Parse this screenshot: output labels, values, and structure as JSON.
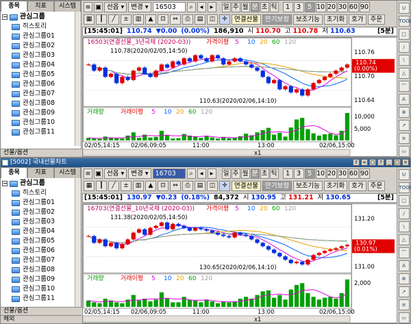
{
  "windows": [
    {
      "title": "",
      "left_tabs": [
        "종목",
        "지표",
        "시스템"
      ],
      "tree_root": "관심그룹",
      "tree_items": [
        "히스토리",
        "관심그룹01",
        "관심그룹02",
        "관심그룹03",
        "관심그룹04",
        "관심그룹05",
        "관심그룹06",
        "관심그룹07",
        "관심그룹08",
        "관심그룹09",
        "관심그룹10",
        "관심그룹11"
      ],
      "left_bottom": "선물/옵션",
      "toolbar": {
        "select_label": "선옵",
        "change_label": "변경",
        "code": "16503",
        "periods": [
          "일",
          "주",
          "월",
          "분",
          "초",
          "틱"
        ],
        "numbers": [
          "1",
          "3",
          "5",
          "10",
          "20",
          "30",
          "60",
          "90"
        ]
      },
      "toolbar2": {
        "linked_label": "연결선물",
        "expiry_label": "만기보정",
        "aux_label": "보조기능",
        "init_label": "초기화",
        "quote_label": "호가",
        "order_label": "주문"
      },
      "info": {
        "time": "[15:45:01]",
        "price": "110.74",
        "change": "▼0.00",
        "pct": "(0.00%)",
        "volume": "186,910",
        "open_label": "시",
        "open": "110.70",
        "high_label": "고",
        "high": "110.78",
        "low_label": "저",
        "low": "110.63",
        "interval": "[5분]"
      },
      "legend_title": "16503(연결선물_3년국채 (2020-03))",
      "legend_ma_label": "가격이평",
      "legend_ma_periods": [
        "5",
        "10",
        "20",
        "60",
        "120"
      ],
      "high_note": "110.78(2020/02/05,14:50)",
      "low_note": "110.63(2020/02/06,14:10)",
      "y_ticks": [
        "110.76",
        "110.70",
        "110.64"
      ],
      "last_price": "110.74",
      "last_pct": "(0.00%)",
      "vol_legend": "거래량",
      "vol_ma_label": "거래이평",
      "vol_ma_periods": [
        "5",
        "10",
        "20",
        "60",
        "120"
      ],
      "vol_ticks": [
        "10,000",
        "5,000"
      ],
      "x_labels": [
        "02/05,14:15",
        "02/06,09:05",
        "11:00",
        "13:00",
        "02/06,15:00"
      ],
      "scale": "x1"
    },
    {
      "title": "[5002] 국내선물차트",
      "left_tabs": [
        "종목",
        "지표",
        "시스템"
      ],
      "tree_root": "관심그룹",
      "tree_items": [
        "히스토리",
        "관심그룹01",
        "관심그룹02",
        "관심그룹03",
        "관심그룹04",
        "관심그룹05",
        "관심그룹06",
        "관심그룹07",
        "관심그룹08",
        "관심그룹09",
        "관심그룹10",
        "관심그룹11"
      ],
      "left_bottom": "선물/옵션",
      "left_bottom2": "해외",
      "toolbar": {
        "select_label": "선옵",
        "change_label": "변경",
        "code": "16703",
        "periods": [
          "일",
          "주",
          "월",
          "분",
          "초",
          "틱"
        ],
        "numbers": [
          "1",
          "3",
          "5",
          "10",
          "20",
          "30",
          "60",
          "90"
        ]
      },
      "toolbar2": {
        "linked_label": "연결선물",
        "expiry_label": "만기보정",
        "aux_label": "보조기능",
        "init_label": "초기화",
        "quote_label": "호가",
        "order_label": "주문"
      },
      "info": {
        "time": "[15:45:01]",
        "price": "130.97",
        "change": "▼0.23",
        "pct": "(0.18%)",
        "volume": "84,372",
        "open_label": "시",
        "open": "130.95",
        "high_label": "고",
        "high": "131.21",
        "low_label": "저",
        "low": "130.65",
        "interval": "[5분]"
      },
      "legend_title": "16703(연결선물_10년국채 (2020-03))",
      "legend_ma_label": "가격이평",
      "legend_ma_periods": [
        "5",
        "10",
        "20",
        "60",
        "120"
      ],
      "high_note": "131.38(2020/02/05,14:50)",
      "low_note": "130.65(2020/02/06,14:10)",
      "y_ticks": [
        "131.20",
        "131.00"
      ],
      "last_price": "130.97",
      "last_pct": "(0.01%)",
      "vol_legend": "거래량",
      "vol_ma_label": "거래이평",
      "vol_ma_periods": [
        "5",
        "10",
        "20",
        "60",
        "120"
      ],
      "vol_ticks": [
        "2,000"
      ],
      "x_labels": [
        "02/05,14:15",
        "02/06,09:05",
        "11:00",
        "13:00",
        "02/06,15:00"
      ],
      "scale": "x1"
    }
  ],
  "right_tools": [
    "U",
    "TOOL",
    "□",
    "/",
    "\\",
    "△",
    "⌒",
    "A",
    "⊕",
    "↗",
    "≡",
    "▭"
  ],
  "colors": {
    "up": "#e00000",
    "down": "#0030e0",
    "ma5": "#e000e0",
    "ma10": "#0060ff",
    "ma20": "#e8a000",
    "ma60": "#00a000",
    "ma120": "#a0a0a0",
    "volume": "#00a000",
    "last_bg": "#e00000"
  },
  "chart_data": [
    {
      "type": "candlestick",
      "title": "16503(연결선물_3년국채 (2020-03))",
      "ylim": [
        110.61,
        110.8
      ],
      "close": [
        110.74,
        110.72,
        110.73,
        110.7,
        110.71,
        110.68,
        110.7,
        110.69,
        110.72,
        110.73,
        110.71,
        110.7,
        110.72,
        110.74,
        110.73,
        110.75,
        110.74,
        110.76,
        110.75,
        110.77,
        110.76,
        110.75,
        110.77,
        110.76,
        110.74,
        110.75,
        110.76,
        110.75,
        110.74,
        110.73,
        110.72,
        110.7,
        110.68,
        110.69,
        110.66,
        110.67,
        110.65,
        110.66,
        110.64,
        110.66,
        110.68,
        110.69,
        110.7,
        110.71,
        110.72,
        110.73,
        110.74
      ],
      "volume": [
        800,
        600,
        500,
        1200,
        900,
        700,
        600,
        1500,
        2500,
        800,
        1800,
        900,
        1100,
        3000,
        1600,
        600,
        700,
        2000,
        1500,
        1200,
        800,
        1400,
        900,
        600,
        1100,
        700,
        800,
        1300,
        2100,
        1600,
        2500,
        3200,
        3900,
        1800,
        2400,
        1200,
        4000,
        6500,
        7000,
        3500,
        2200,
        1500,
        1900,
        2100,
        1600,
        3000,
        8500
      ]
    },
    {
      "type": "candlestick",
      "title": "16703(연결선물_10년국채 (2020-03))",
      "ylim": [
        130.58,
        131.45
      ],
      "close": [
        131.1,
        131.0,
        131.05,
        130.95,
        131.0,
        130.92,
        130.98,
        131.05,
        131.15,
        131.2,
        131.12,
        131.22,
        131.25,
        131.3,
        131.2,
        131.28,
        131.25,
        131.22,
        131.18,
        131.22,
        131.2,
        131.18,
        131.15,
        131.12,
        131.1,
        131.08,
        131.15,
        131.12,
        131.1,
        131.05,
        131.0,
        130.95,
        130.9,
        130.85,
        130.8,
        130.75,
        130.7,
        130.72,
        130.68,
        130.75,
        130.82,
        130.85,
        130.88,
        130.9,
        130.92,
        130.95,
        130.97
      ],
      "volume": [
        700,
        500,
        400,
        900,
        700,
        500,
        400,
        800,
        1300,
        700,
        900,
        600,
        800,
        1600,
        900,
        500,
        500,
        1100,
        800,
        700,
        500,
        800,
        600,
        400,
        600,
        500,
        600,
        900,
        1100,
        900,
        1300,
        1700,
        1800,
        1000,
        1300,
        800,
        1900,
        2400,
        2600,
        1500,
        1100,
        800,
        1000,
        1100,
        900,
        1500,
        3000
      ]
    }
  ]
}
